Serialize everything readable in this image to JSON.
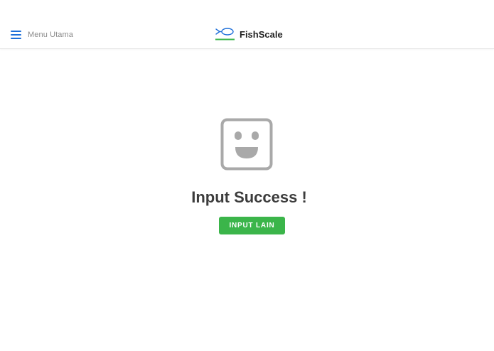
{
  "header": {
    "menu_label": "Menu Utama",
    "brand_name": "FishScale",
    "menu_icon": "hamburger-icon",
    "logo_icon": "fish-logo-icon"
  },
  "main": {
    "illustration_icon": "smiley-face-icon",
    "title": "Input Success !",
    "button_label": "INPUT LAIN"
  },
  "colors": {
    "accent_blue": "#1e6fd9",
    "button_green": "#3bb54a",
    "logo_underline_green": "#3bb54a",
    "icon_gray": "#a9a9a9",
    "title_text": "#3c3c3c"
  }
}
